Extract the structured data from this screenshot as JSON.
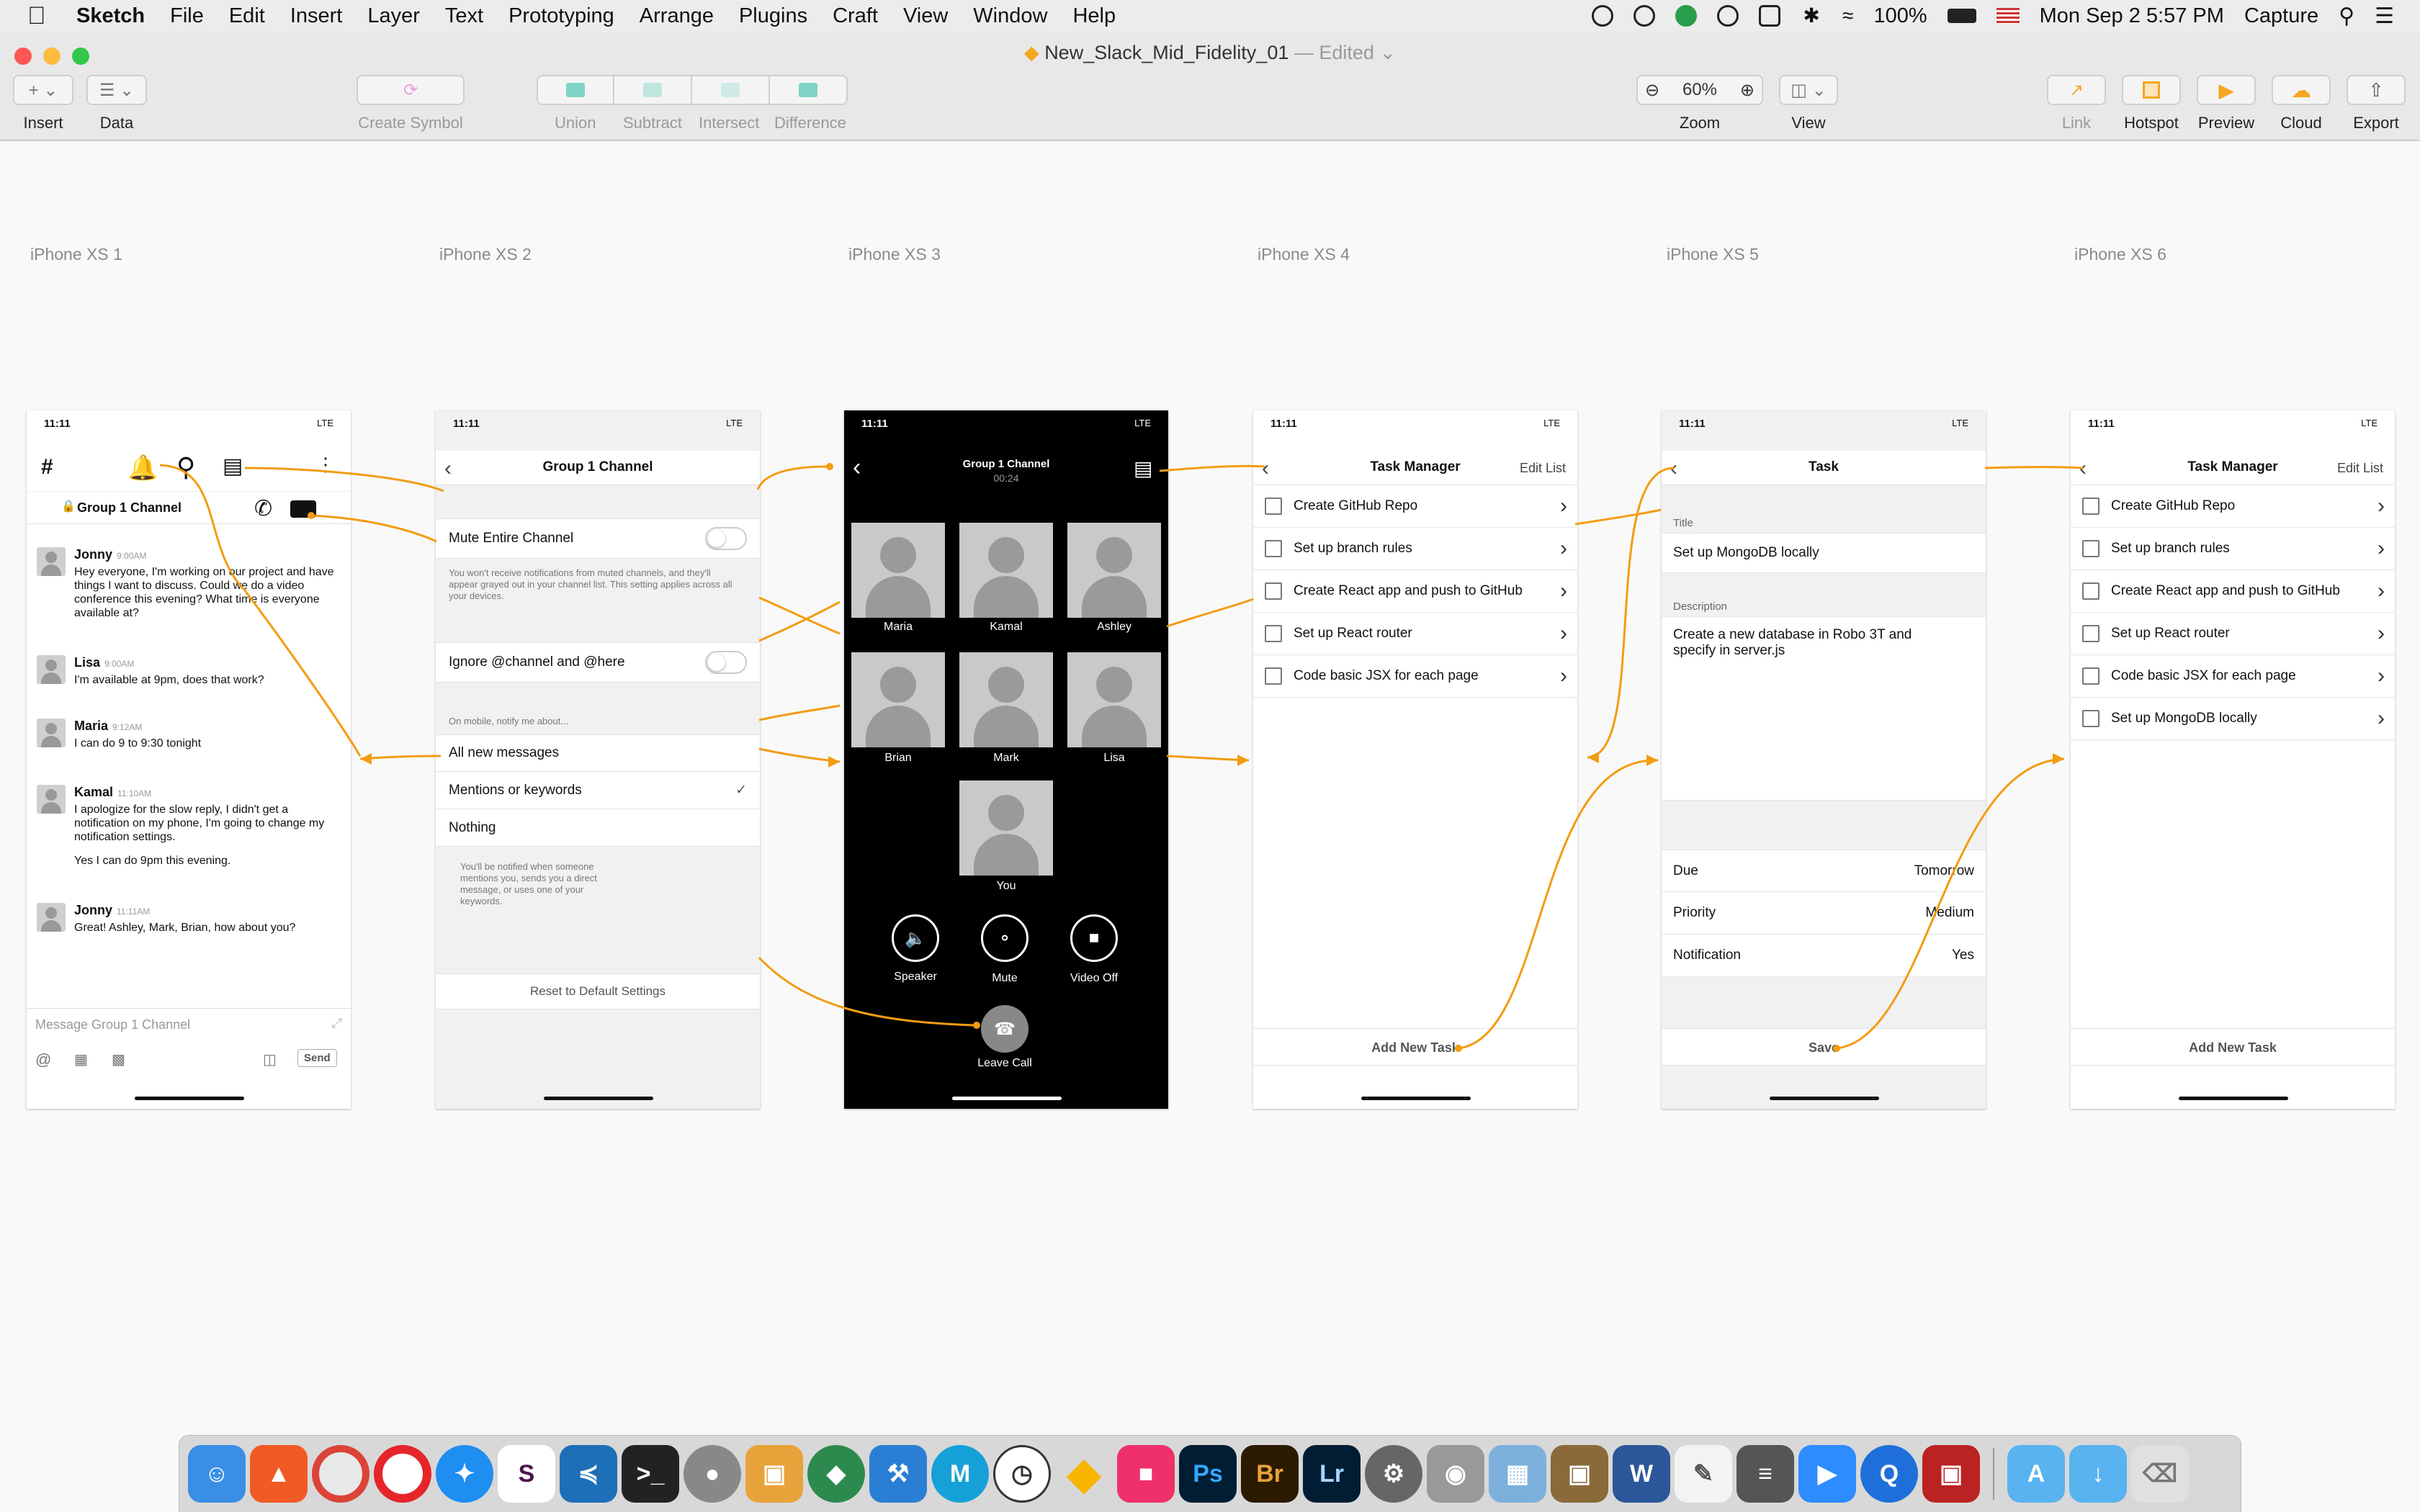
{
  "menubar": {
    "app": "Sketch",
    "items": [
      "File",
      "Edit",
      "Insert",
      "Layer",
      "Text",
      "Prototyping",
      "Arrange",
      "Plugins",
      "Craft",
      "View",
      "Window",
      "Help"
    ],
    "battery": "100%",
    "datetime": "Mon Sep 2  5:57 PM",
    "capture": "Capture"
  },
  "window": {
    "doc_name": "New_Slack_Mid_Fidelity_01",
    "edited": "— Edited",
    "toolbar": {
      "insert": "Insert",
      "data": "Data",
      "create_symbol": "Create Symbol",
      "union": "Union",
      "subtract": "Subtract",
      "intersect": "Intersect",
      "difference": "Difference",
      "zoom_value": "60%",
      "zoom": "Zoom",
      "view": "View",
      "link": "Link",
      "hotspot": "Hotspot",
      "preview": "Preview",
      "cloud": "Cloud",
      "export": "Export"
    }
  },
  "colors": {
    "connector": "#f39c12",
    "call_bg": "#000000",
    "hotspot": "#f5a623"
  },
  "artboards": {
    "a1": {
      "label": "iPhone XS 1",
      "time": "11:11",
      "sig": "LTE",
      "channel": "Group 1 Channel",
      "messages": [
        {
          "name": "Jonny",
          "time": "9:00AM",
          "text": "Hey everyone, I'm working on our project and have things I want to discuss.  Could we do a video conference this evening?  What time is everyone available at?"
        },
        {
          "name": "Lisa",
          "time": "9:00AM",
          "text": "I'm available at 9pm, does that work?"
        },
        {
          "name": "Maria",
          "time": "9:12AM",
          "text": "I can do 9 to 9:30 tonight"
        },
        {
          "name": "Kamal",
          "time": "11:10AM",
          "text": "I apologize for the slow reply, I didn't get a notification on my phone, I'm going to change my notification settings."
        },
        {
          "name": "Jonny",
          "time": "11:11AM",
          "text": "Great!  Ashley, Mark, Brian, how about you?"
        }
      ],
      "kamal_extra": "Yes I can do 9pm this evening.",
      "input_placeholder": "Message Group 1 Channel",
      "send": "Send"
    },
    "a2": {
      "label": "iPhone XS 2",
      "time": "11:11",
      "sig": "LTE",
      "title": "Group 1 Channel",
      "mute": "Mute Entire Channel",
      "mute_note": "You won't receive notifications from muted channels, and they'll appear grayed out in your channel list. This setting applies across all your devices.",
      "ignore": "Ignore @channel and @here",
      "notify_head": "On mobile, notify me about...",
      "opt1": "All new messages",
      "opt2": "Mentions or keywords",
      "opt3": "Nothing",
      "note2": "You'll be notified when someone mentions you, sends you a direct message, or uses one of your keywords.",
      "reset": "Reset to Default Settings"
    },
    "a3": {
      "label": "iPhone XS 3",
      "time": "11:11",
      "sig": "LTE",
      "title": "Group 1 Channel",
      "duration": "00:24",
      "people": [
        "Maria",
        "Kamal",
        "Ashley",
        "Brian",
        "Mark",
        "Lisa",
        "You"
      ],
      "speaker": "Speaker",
      "mute": "Mute",
      "video": "Video Off",
      "leave": "Leave Call"
    },
    "a4": {
      "label": "iPhone XS 4",
      "time": "11:11",
      "sig": "LTE",
      "title": "Task Manager",
      "edit": "Edit List",
      "tasks": [
        "Create GitHub Repo",
        "Set up branch rules",
        "Create React app and push to GitHub",
        "Set up React router",
        "Code basic JSX for each page"
      ],
      "add": "Add New Task"
    },
    "a5": {
      "label": "iPhone XS 5",
      "time": "11:11",
      "sig": "LTE",
      "title": "Task",
      "title_label": "Title",
      "title_value": "Set up MongoDB locally",
      "desc_label": "Description",
      "desc_value": "Create a new database in Robo 3T and specify in server.js",
      "due": "Due",
      "due_value": "Tomorrow",
      "priority": "Priority",
      "priority_value": "Medium",
      "notification": "Notification",
      "notification_value": "Yes",
      "save": "Save"
    },
    "a6": {
      "label": "iPhone XS 6",
      "time": "11:11",
      "sig": "LTE",
      "title": "Task Manager",
      "edit": "Edit List",
      "tasks": [
        "Create GitHub Repo",
        "Set up branch rules",
        "Create React app and push to GitHub",
        "Set up React router",
        "Code basic JSX for each page",
        "Set up MongoDB locally"
      ],
      "add": "Add New Task"
    }
  },
  "dock": {
    "apps": [
      "finder",
      "brave",
      "chrome",
      "opera",
      "safari",
      "slack",
      "vscode",
      "terminal",
      "tableplus",
      "sequel",
      "sourcetree",
      "xcode",
      "markdown",
      "clock",
      "sketch",
      "screens",
      "photoshop",
      "bridge",
      "lightroom",
      "system-prefs",
      "disk-utility",
      "preview",
      "archive",
      "word",
      "textedit",
      "calculator",
      "zoom",
      "quicktime",
      "photo-booth",
      "applications",
      "downloads",
      "trash"
    ]
  }
}
